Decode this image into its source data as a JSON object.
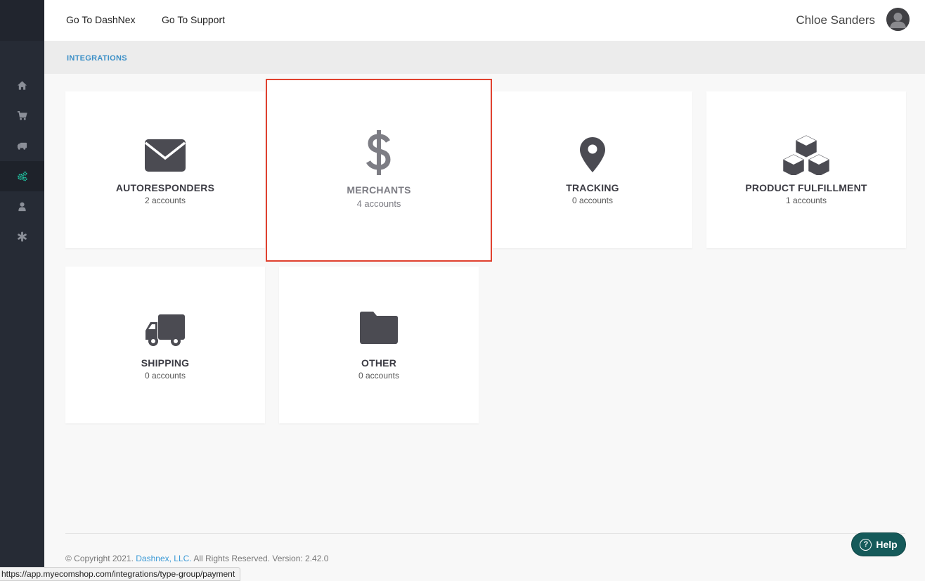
{
  "topbar": {
    "links": [
      "Go To DashNex",
      "Go To Support"
    ],
    "user_name": "Chloe Sanders"
  },
  "breadcrumb": "INTEGRATIONS",
  "sidebar": {
    "items": [
      {
        "icon": "home-icon"
      },
      {
        "icon": "cart-icon"
      },
      {
        "icon": "truck-icon"
      },
      {
        "icon": "gears-icon",
        "active": true
      },
      {
        "icon": "user-icon"
      },
      {
        "icon": "asterisk-icon"
      }
    ],
    "accent_color": "#1fc9a5"
  },
  "cards": [
    {
      "title": "AUTORESPONDERS",
      "subtitle": "2 accounts",
      "icon": "envelope-icon"
    },
    {
      "title": "MERCHANTS",
      "subtitle": "4 accounts",
      "icon": "dollar-icon",
      "highlighted": true
    },
    {
      "title": "TRACKING",
      "subtitle": "0 accounts",
      "icon": "map-marker-icon"
    },
    {
      "title": "PRODUCT FULFILLMENT",
      "subtitle": "1 accounts",
      "icon": "cubes-icon"
    },
    {
      "title": "SHIPPING",
      "subtitle": "0 accounts",
      "icon": "truck-icon"
    },
    {
      "title": "OTHER",
      "subtitle": "0 accounts",
      "icon": "folder-icon"
    }
  ],
  "footer": {
    "prefix": "© Copyright 2021.",
    "company": "Dashnex, LLC.",
    "suffix": "All Rights Reserved. Version: 2.42.0"
  },
  "help_button": "Help",
  "status_url": "https://app.myecomshop.com/integrations/type-group/payment",
  "colors": {
    "highlight_border": "#e0412f",
    "help_button_bg": "#155a5a",
    "link": "#3b9ad6"
  }
}
